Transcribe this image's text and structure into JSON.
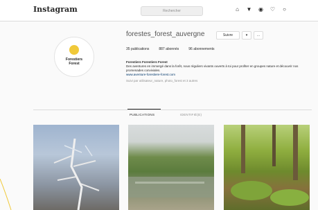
{
  "header": {
    "logo": "Instagram",
    "search_placeholder": "Rechercher"
  },
  "nav_icons": [
    "home-icon",
    "explore-icon",
    "compass-icon",
    "heart-icon",
    "profile-icon"
  ],
  "profile": {
    "username": "forestes_forest_auvergne",
    "follow_label": "Suivre",
    "options_label": "…",
    "avatar_line1": "Forestiers",
    "avatar_line2": "Forest",
    "stats": {
      "posts": "35 publications",
      "followers": "887 abonnés",
      "following": "96 abonnements"
    },
    "bio_name": "Forestiers Forestiers Forest",
    "bio_text": "Des aventures en immergé dans la forêt, nous réguliers vivants ouverts à toi pour profiter en groupes nature et découvrir nos promenades conviviales.",
    "bio_link": "www.aventure-forestiere-forest.com",
    "followed_by": "Suivi par utilisateur_nature, photo_forest et 3 autres"
  },
  "tabs": {
    "posts": "PUBLICATIONS",
    "tagged": "IDENTIFIÉ(E)"
  },
  "colors": {
    "accent": "#f0c93a",
    "border": "#dbdbdb",
    "text": "#262626"
  }
}
